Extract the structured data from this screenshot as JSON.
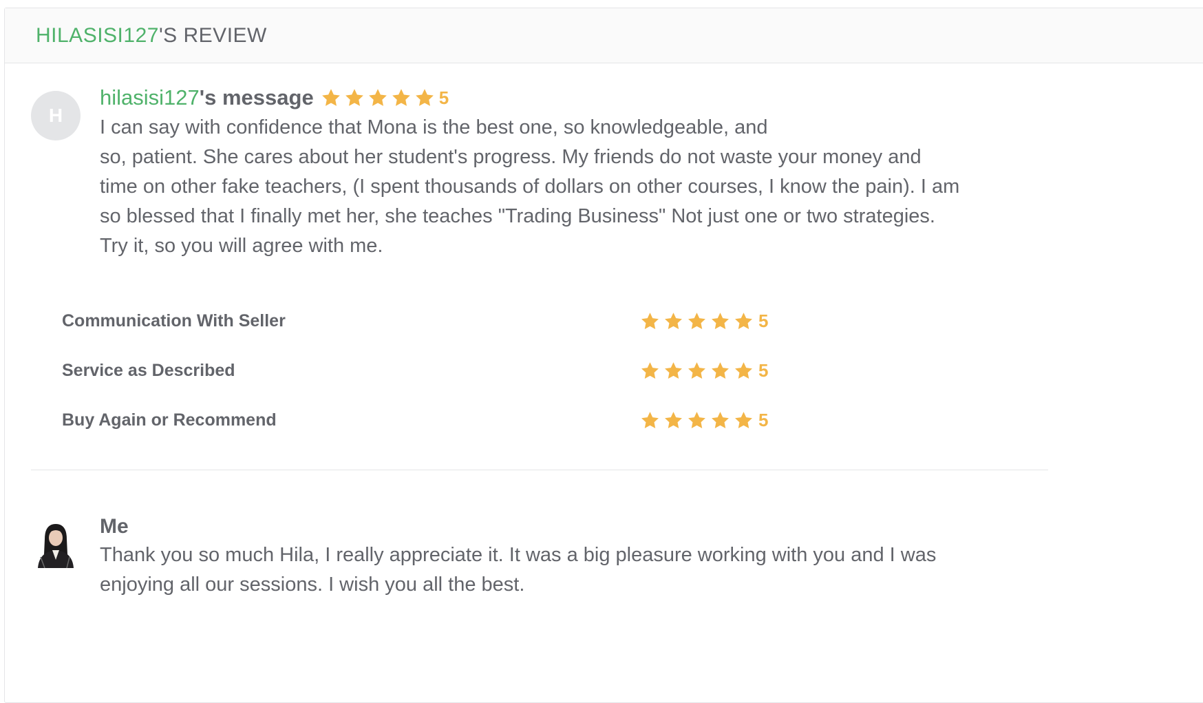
{
  "header": {
    "username": "HILASISI127",
    "suffix": "'S REVIEW"
  },
  "review": {
    "avatar_letter": "H",
    "username": "hilasisi127",
    "title_suffix": "'s message",
    "rating": "5",
    "stars_filled": 5,
    "lines": [
      "I can say with confidence that Mona is the best one, so knowledgeable, and",
      "so, patient. She cares about her student's progress. My friends do not waste your money and",
      "time on other fake teachers, (I spent thousands of dollars on other courses, I know the pain). I am",
      "so blessed that I finally met her, she teaches \"Trading Business\" Not just one or two strategies.",
      "Try it, so you will agree with me."
    ]
  },
  "ratings": [
    {
      "label": "Communication With Seller",
      "value": "5",
      "stars_filled": 5
    },
    {
      "label": "Service as Described",
      "value": "5",
      "stars_filled": 5
    },
    {
      "label": "Buy Again or Recommend",
      "value": "5",
      "stars_filled": 5
    }
  ],
  "reply": {
    "name": "Me",
    "lines": [
      "Thank you so much Hila, I really appreciate it. It was a big pleasure working with you and I was",
      "enjoying all our sessions. I wish you all the best."
    ]
  },
  "colors": {
    "star": "#f3b547",
    "username_green": "#4fb26a",
    "text": "#62646a"
  }
}
